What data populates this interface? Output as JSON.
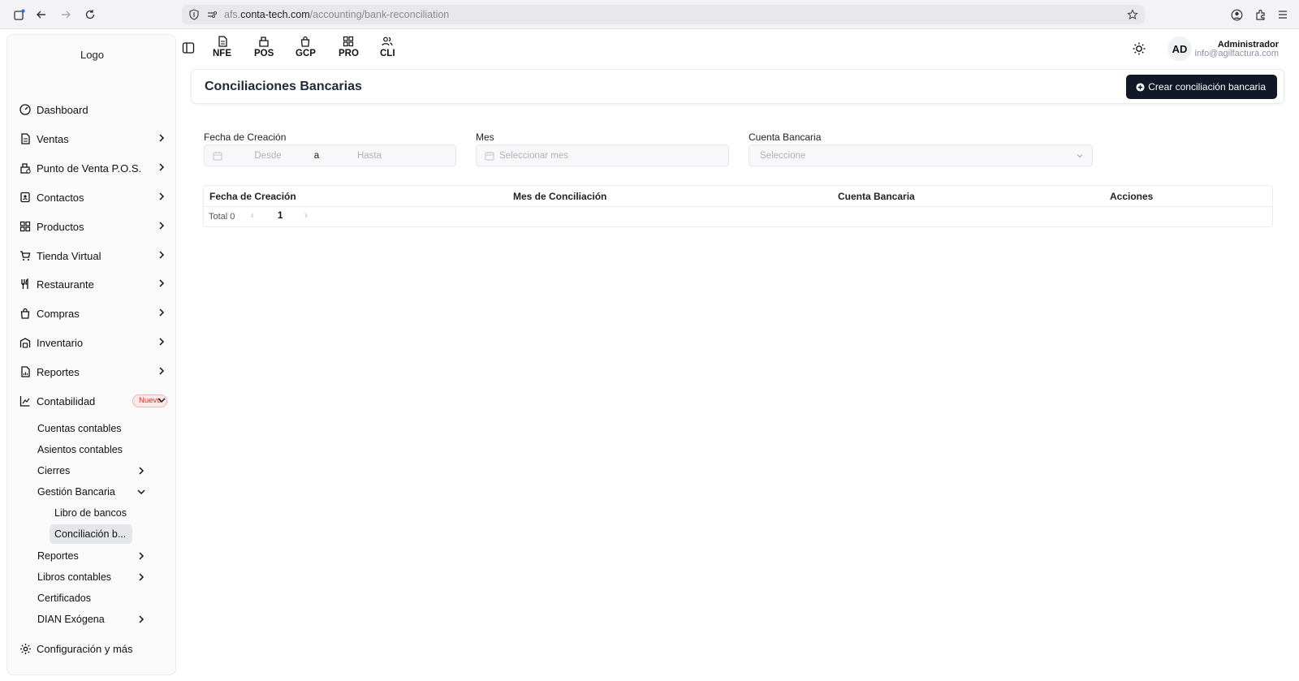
{
  "browser": {
    "url_prefix": "afs.",
    "url_host": "conta-tech.com",
    "url_path": "/accounting/bank-reconciliation"
  },
  "sidebar": {
    "logo": "Logo",
    "items": [
      {
        "label": "Dashboard",
        "icon": "dashboard-icon"
      },
      {
        "label": "Ventas",
        "icon": "document-icon"
      },
      {
        "label": "Punto de Venta P.O.S.",
        "icon": "register-icon"
      },
      {
        "label": "Contactos",
        "icon": "contacts-icon"
      },
      {
        "label": "Productos",
        "icon": "grid-icon"
      },
      {
        "label": "Tienda Virtual",
        "icon": "cart-icon"
      },
      {
        "label": "Restaurante",
        "icon": "utensils-icon"
      },
      {
        "label": "Compras",
        "icon": "shopping-bag-icon"
      },
      {
        "label": "Inventario",
        "icon": "warehouse-icon"
      },
      {
        "label": "Reportes",
        "icon": "report-icon"
      },
      {
        "label": "Contabilidad",
        "icon": "chart-icon",
        "badge": "Nuevo"
      }
    ],
    "sub_items": [
      {
        "label": "Cuentas contables"
      },
      {
        "label": "Asientos contables"
      },
      {
        "label": "Cierres"
      },
      {
        "label": "Gestión Bancaria"
      },
      {
        "label": "Reportes"
      },
      {
        "label": "Libros contables"
      },
      {
        "label": "Certificados"
      },
      {
        "label": "DIAN Exógena"
      }
    ],
    "bank_items": [
      {
        "label": "Libro de bancos"
      },
      {
        "label": "Conciliación b..."
      }
    ],
    "settings": "Configuración y más"
  },
  "topnav": [
    {
      "label": "NFE"
    },
    {
      "label": "POS"
    },
    {
      "label": "GCP"
    },
    {
      "label": "PRO"
    },
    {
      "label": "CLI"
    }
  ],
  "user": {
    "initials": "AD",
    "name": "Administrador",
    "email": "info@agilfactura.com"
  },
  "page": {
    "title": "Conciliaciones Bancarias",
    "create_button": "Crear conciliación bancaria"
  },
  "filters": {
    "date_label": "Fecha de Creación",
    "date_from_placeholder": "Desde",
    "date_separator": "a",
    "date_to_placeholder": "Hasta",
    "month_label": "Mes",
    "month_placeholder": "Seleccionar mes",
    "account_label": "Cuenta Bancaria",
    "account_placeholder": "Seleccione"
  },
  "table": {
    "columns": [
      "Fecha de Creación",
      "Mes de Conciliación",
      "Cuenta Bancaria",
      "Acciones"
    ],
    "rows": [],
    "total_label": "Total 0",
    "current_page": "1"
  },
  "colors": {
    "primary_button": "#111827",
    "badge_text": "#d92d2d",
    "badge_bg": "#fde8e8"
  }
}
